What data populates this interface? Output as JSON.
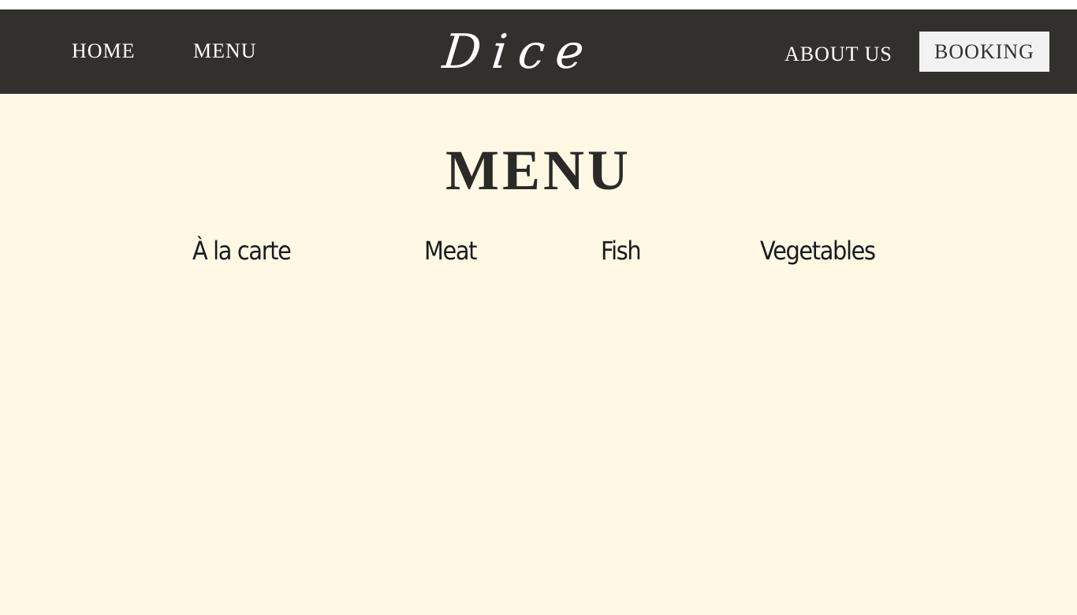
{
  "nav": {
    "home": "HOME",
    "menu": "MENU",
    "logo": "Dice",
    "about": "ABOUT US",
    "booking": "BOOKING"
  },
  "main": {
    "title": "MENU",
    "categories": [
      "À la carte",
      "Meat",
      "Fish",
      "Vegetables"
    ]
  },
  "colors": {
    "navbar": "#32302d",
    "page_background": "#fef8e5",
    "booking_button": "#f2f2f2",
    "text_dark": "#2b2a27"
  }
}
